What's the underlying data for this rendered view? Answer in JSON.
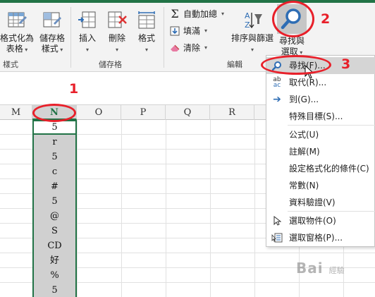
{
  "ribbon": {
    "format_as_table_label": "格式化為\n表格",
    "cell_styles_label": "儲存格\n樣式",
    "styles_group": "樣式",
    "insert_label": "插入",
    "delete_label": "刪除",
    "format_label": "格式",
    "cells_group": "儲存格",
    "autosum_label": "自動加總",
    "fill_label": "填滿",
    "clear_label": "清除",
    "editing_group": "編輯",
    "sort_filter_label": "排序與篩選",
    "find_select_label": "尋找與\n選取"
  },
  "columns": [
    "M",
    "N",
    "O",
    "P",
    "Q",
    "R"
  ],
  "cells": [
    "5",
    "r",
    "5",
    "c",
    "#",
    "5",
    "@",
    "S",
    "CD",
    "好",
    "%",
    "5"
  ],
  "menu": {
    "items": [
      {
        "label": "尋找(F)...",
        "icon": "find-icon"
      },
      {
        "label": "取代(R)...",
        "icon": "replace-icon"
      },
      {
        "label": "到(G)...",
        "icon": "go-to-arrow-icon"
      },
      {
        "label": "特殊目標(S)...",
        "icon": ""
      },
      {
        "label": "公式(U)",
        "icon": ""
      },
      {
        "label": "註解(M)",
        "icon": ""
      },
      {
        "label": "設定格式化的條件(C)",
        "icon": ""
      },
      {
        "label": "常數(N)",
        "icon": ""
      },
      {
        "label": "資料驗證(V)",
        "icon": ""
      },
      {
        "label": "選取物件(O)",
        "icon": "select-objects-icon"
      },
      {
        "label": "選取窗格(P)...",
        "icon": "selection-pane-icon"
      }
    ]
  },
  "annotations": {
    "one": "1",
    "two": "2",
    "three": "3"
  },
  "watermark": {
    "text": "Bai",
    "sub": "經驗"
  },
  "colors": {
    "accent": "#217346",
    "annotation": "#e8202a",
    "selection": "#d0d0d0"
  }
}
